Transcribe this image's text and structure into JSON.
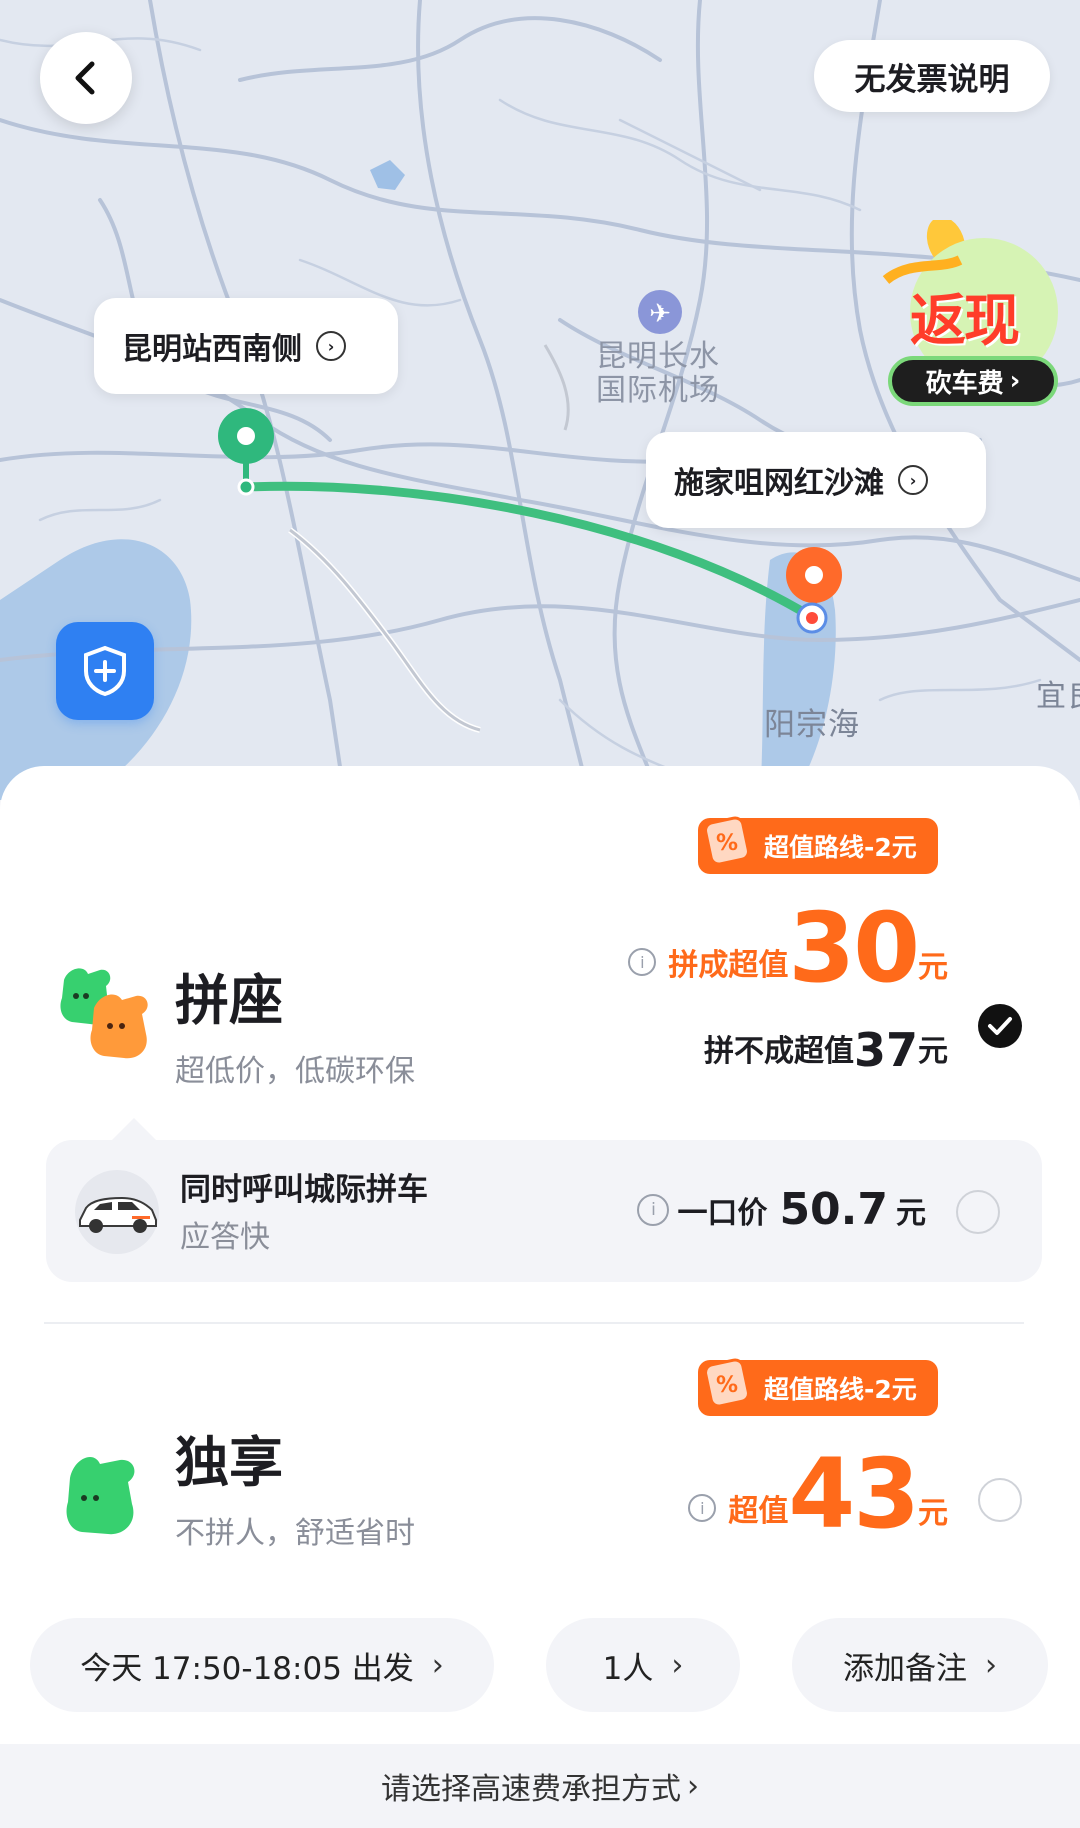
{
  "header": {
    "back_label": "返回",
    "invoice_label": "无发票说明"
  },
  "map": {
    "origin_label": "昆明站西南侧",
    "destination_label": "施家咀网红沙滩",
    "airport_label_line1": "昆明长水",
    "airport_label_line2": "国际机场",
    "lake_label": "阳宗海",
    "edge_label": "宜良",
    "cashback_title": "返现",
    "cashback_sub": "砍车费",
    "route_color": "#3fbf7f",
    "origin_pin_color": "#2fb87d",
    "destination_pin_color": "#ff6a2a"
  },
  "products": {
    "carpool": {
      "promo": "超值路线-2元",
      "name": "拼座",
      "subtitle": "超低价，低碳环保",
      "price_label": "拼成超值",
      "price": "30",
      "unit": "元",
      "alt_label": "拼不成超值",
      "alt_price": "37",
      "alt_unit": "元",
      "selected": true
    },
    "intercity": {
      "title": "同时呼叫城际拼车",
      "subtitle": "应答快",
      "price_label": "一口价",
      "price": "50.7",
      "unit": "元",
      "selected": false
    },
    "exclusive": {
      "promo": "超值路线-2元",
      "name": "独享",
      "subtitle": "不拼人，舒适省时",
      "price_label": "超值",
      "price": "43",
      "unit": "元",
      "selected": false
    }
  },
  "options": {
    "time_label": "今天 17:50-18:05 出发",
    "passengers_label": "1人",
    "note_label": "添加备注",
    "arrow": "›"
  },
  "footer": {
    "highway_fee_label": "请选择高速费承担方式",
    "arrow": "›"
  },
  "colors": {
    "accent_orange": "#ff6a1a",
    "brand_green": "#34c77b"
  }
}
